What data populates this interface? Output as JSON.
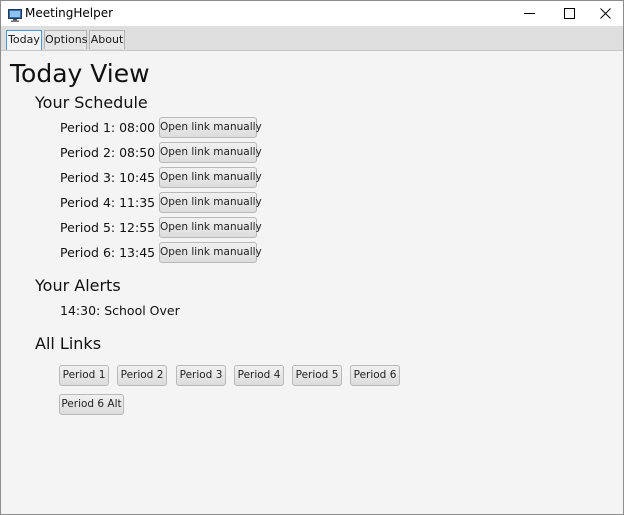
{
  "window": {
    "title": "MeetingHelper"
  },
  "tabs": [
    {
      "label": "Today",
      "active": true
    },
    {
      "label": "Options",
      "active": false
    },
    {
      "label": "About",
      "active": false
    }
  ],
  "page": {
    "title": "Today View"
  },
  "schedule": {
    "heading": "Your Schedule",
    "button_label": "Open link manually",
    "periods": [
      {
        "label": "Period 1: 08:00"
      },
      {
        "label": "Period 2: 08:50"
      },
      {
        "label": "Period 3: 10:45"
      },
      {
        "label": "Period 4: 11:35"
      },
      {
        "label": "Period 5: 12:55"
      },
      {
        "label": "Period 6: 13:45"
      }
    ]
  },
  "alerts": {
    "heading": "Your Alerts",
    "items": [
      "14:30: School Over"
    ]
  },
  "links": {
    "heading": "All Links",
    "buttons": [
      "Period 1",
      "Period 2",
      "Period 3",
      "Period 4",
      "Period 5",
      "Period 6",
      "Period 6 Alt"
    ]
  },
  "colors": {
    "accent_tab_border": "#4a9ad8",
    "background": "#f4f4f4"
  },
  "icons": {
    "app": "computer-monitor-icon",
    "minimize": "minimize-icon",
    "maximize": "maximize-icon",
    "close": "close-icon"
  }
}
